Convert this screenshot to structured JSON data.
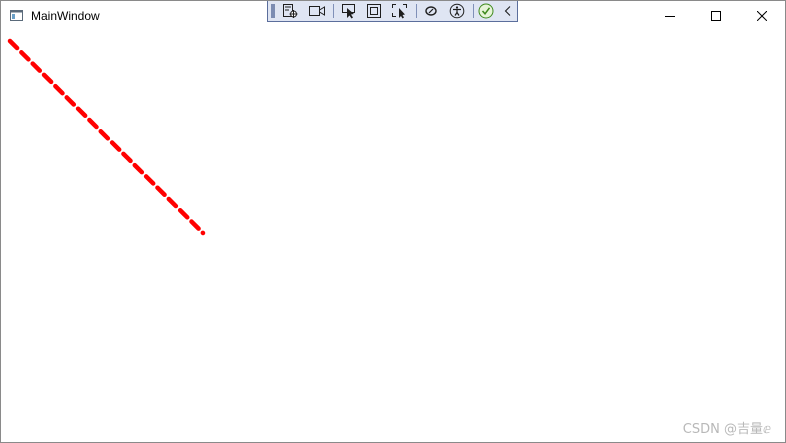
{
  "window": {
    "title": "MainWindow",
    "caption_buttons": {
      "minimize_icon": "minimize-icon",
      "maximize_icon": "maximize-icon",
      "close_icon": "close-icon"
    }
  },
  "debug_toolbar": {
    "items": [
      "go-to-live-visual-tree-icon",
      "record-icon",
      "select-element-icon",
      "display-layout-adorners-icon",
      "track-focused-element-icon",
      "binding-failures-icon",
      "accessibility-scanner-icon",
      "hot-reload-status-icon",
      "collapse-chevron-icon"
    ]
  },
  "canvas": {
    "line_color": "#ff0000",
    "line_style": "dashed"
  },
  "watermark": "CSDN @吉量ⅇ"
}
